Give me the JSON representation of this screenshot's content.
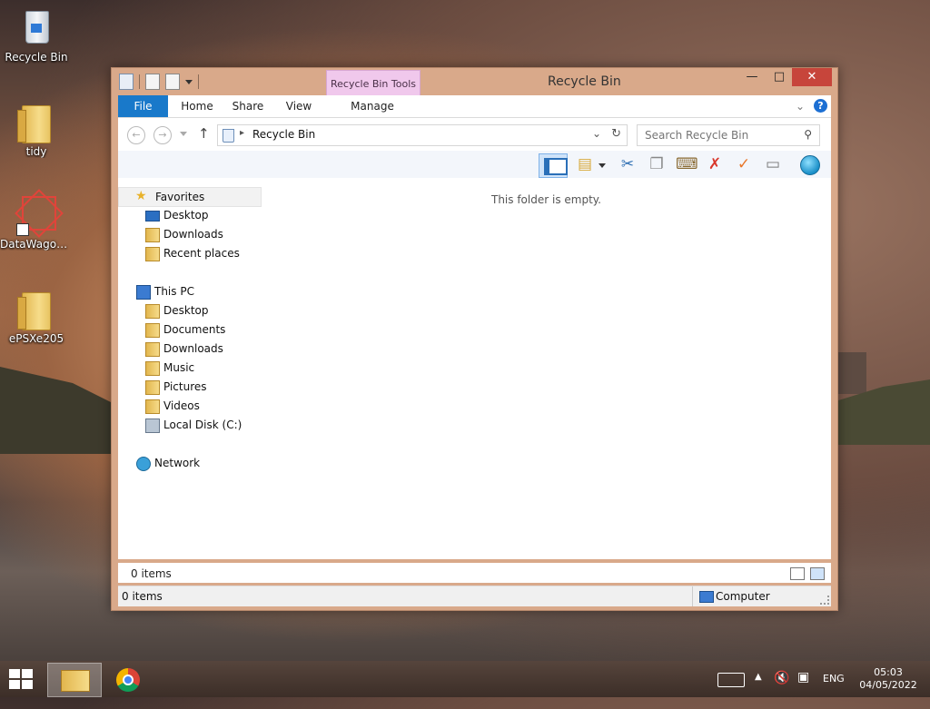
{
  "desktop": {
    "icons": [
      {
        "label": "Recycle Bin"
      },
      {
        "label": "tidy"
      },
      {
        "label": "DataWagon..."
      },
      {
        "label": "ePSXe205"
      }
    ]
  },
  "window": {
    "title": "Recycle Bin",
    "context_tab": "Recycle Bin Tools",
    "tabs": [
      "File",
      "Home",
      "Share",
      "View",
      "Manage"
    ],
    "address": {
      "crumb": "Recycle Bin"
    },
    "search_placeholder": "Search Recycle Bin",
    "empty_message": "This folder is empty.",
    "nav": {
      "favorites": "Favorites",
      "favorites_items": [
        "Desktop",
        "Downloads",
        "Recent places"
      ],
      "this_pc": "This PC",
      "pc_items": [
        "Desktop",
        "Documents",
        "Downloads",
        "Music",
        "Pictures",
        "Videos",
        "Local Disk (C:)"
      ],
      "network": "Network"
    },
    "inner_status": "0 items",
    "status_left": "0 items",
    "status_right": "Computer"
  },
  "taskbar": {
    "language": "ENG",
    "time": "05:03",
    "date": "04/05/2022"
  }
}
